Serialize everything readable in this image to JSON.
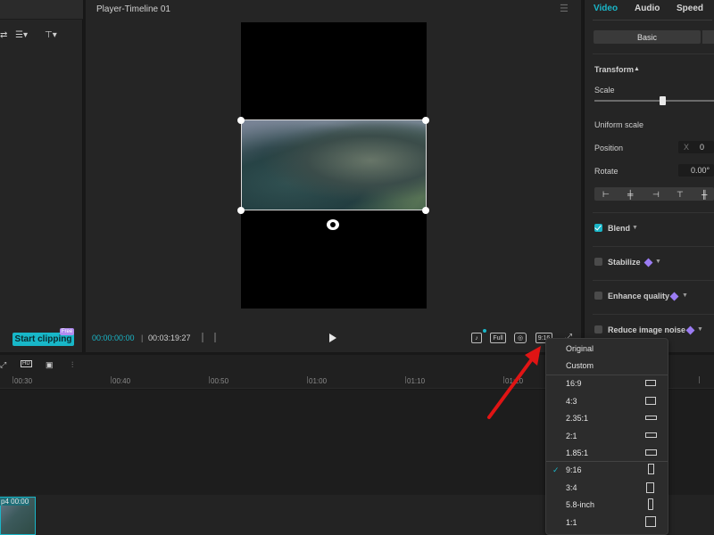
{
  "player": {
    "title": "Player-Timeline 01",
    "time_current": "00:00:00:00",
    "time_separator": "|",
    "time_total": "00:03:19:27",
    "full_label": "Full",
    "ratio_label": "9:16"
  },
  "left": {
    "start_clipping": "Start clipping",
    "free_badge": "Free"
  },
  "inspector": {
    "tabs": [
      "Video",
      "Audio",
      "Speed"
    ],
    "basic_tab": "Basic",
    "transform": "Transform",
    "scale": "Scale",
    "scale_value": 0.55,
    "uniform_scale": "Uniform scale",
    "position": "Position",
    "position_x_label": "X",
    "position_x_value": "0",
    "rotate": "Rotate",
    "rotate_value": "0.00°",
    "blend": "Blend",
    "stabilize": "Stabilize",
    "enhance_quality": "Enhance quality",
    "reduce_image_noise": "Reduce image noise",
    "accent": "#1ab6c8",
    "pro_color": "#9b7cf3"
  },
  "timeline": {
    "ticks": [
      "00:30",
      "00:40",
      "00:50",
      "01:00",
      "01:10",
      "01:20"
    ],
    "clip_label": "p4  00:00"
  },
  "ratio_menu": {
    "items_top": [
      "Original",
      "Custom"
    ],
    "items": [
      "16:9",
      "4:3",
      "2.35:1",
      "2:1",
      "1.85:1",
      "9:16",
      "3:4",
      "5.8-inch",
      "1:1"
    ],
    "selected": "9:16"
  }
}
